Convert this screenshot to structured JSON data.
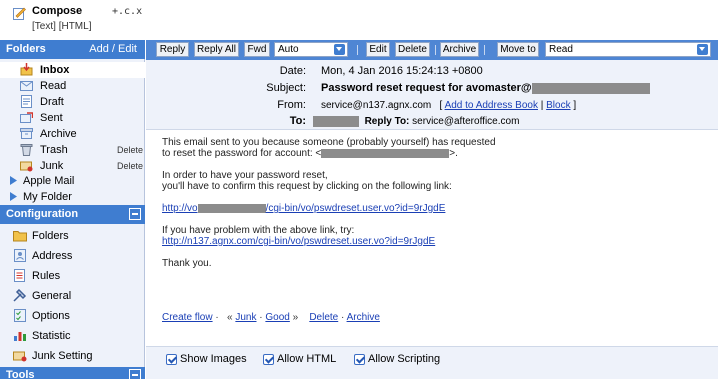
{
  "compose": {
    "label": "Compose",
    "cx": "+.c.x",
    "text_mode": "[Text]",
    "html_mode": "[HTML]"
  },
  "folders": {
    "title": "Folders",
    "action": "Add / Edit",
    "items": [
      {
        "label": "Inbox",
        "icon": "inbox-icon"
      },
      {
        "label": "Read",
        "icon": "read-icon"
      },
      {
        "label": "Draft",
        "icon": "draft-icon"
      },
      {
        "label": "Sent",
        "icon": "sent-icon"
      },
      {
        "label": "Archive",
        "icon": "archive-icon"
      },
      {
        "label": "Trash",
        "icon": "trash-icon",
        "delete": "Delete"
      },
      {
        "label": "Junk",
        "icon": "junk-icon",
        "delete": "Delete"
      },
      {
        "label": "Apple Mail"
      },
      {
        "label": "My Folder"
      }
    ]
  },
  "configuration": {
    "title": "Configuration",
    "items": [
      {
        "label": "Folders",
        "icon": "folders-icon"
      },
      {
        "label": "Address",
        "icon": "address-icon"
      },
      {
        "label": "Rules",
        "icon": "rules-icon"
      },
      {
        "label": "General",
        "icon": "general-icon"
      },
      {
        "label": "Options",
        "icon": "options-icon"
      },
      {
        "label": "Statistic",
        "icon": "statistic-icon"
      },
      {
        "label": "Junk Setting",
        "icon": "junk-setting-icon"
      }
    ]
  },
  "tools": {
    "title": "Tools"
  },
  "toolbar": {
    "reply": "Reply",
    "reply_all": "Reply All",
    "fwd": "Fwd",
    "fwd_mode": "Auto",
    "edit": "Edit",
    "delete": "Delete",
    "archive": "Archive",
    "move_to": "Move to",
    "move_target": "Read"
  },
  "message": {
    "date_label": "Date:",
    "date": "Mon, 4 Jan 2016 15:24:13 +0800",
    "subject_label": "Subject:",
    "subject": "Password reset request for avomaster@",
    "from_label": "From:",
    "from": "service@n137.agnx.com",
    "add_to_address_book": "Add to Address Book",
    "block": "Block",
    "to_label": "To:",
    "reply_to_label": "Reply To:",
    "reply_to": "service@afteroffice.com",
    "body": {
      "p1_line1": "This email sent to you because someone (probably yourself) has requested",
      "p1_line2_prefix": "to reset the password for account: <",
      "p1_line2_suffix": ">.",
      "p2_line1": "In order to have your password reset,",
      "p2_line2": "you'll have to confirm this request by clicking on the following link:",
      "link1_prefix": "http://vo",
      "link1_suffix": "/cgi-bin/vo/pswdreset.user.vo?id=9rJgdE",
      "p3_line1": "If you have problem with the above link, try:",
      "link2": "http://n137.agnx.com/cgi-bin/vo/pswdreset.user.vo?id=9rJgdE",
      "thanks": "Thank you."
    }
  },
  "actions": {
    "create_flow": "Create flow",
    "junk": "Junk",
    "good": "Good",
    "delete": "Delete",
    "archive": "Archive"
  },
  "options": {
    "show_images": "Show Images",
    "allow_html": "Allow HTML",
    "allow_scripting": "Allow Scripting"
  }
}
